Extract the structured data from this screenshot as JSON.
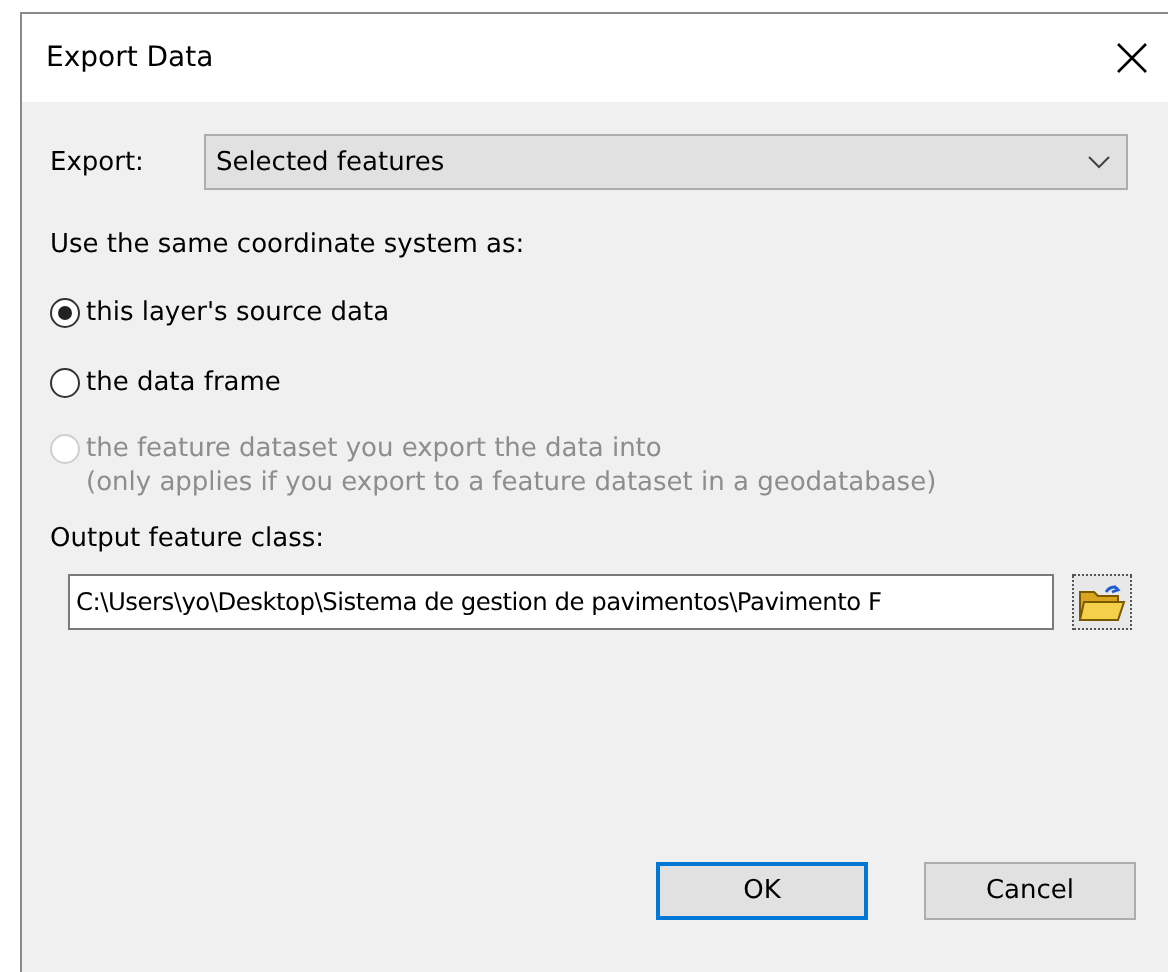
{
  "window": {
    "title": "Export Data"
  },
  "export": {
    "label": "Export:",
    "value": "Selected features"
  },
  "coordinate_heading": "Use the same coordinate system as:",
  "options": [
    {
      "label": "this layer's source data",
      "selected": true,
      "disabled": false
    },
    {
      "label": "the data frame",
      "selected": false,
      "disabled": false
    },
    {
      "label": "the feature dataset you export the data into",
      "note": "(only applies if you export to a feature dataset in a geodatabase)",
      "selected": false,
      "disabled": true
    }
  ],
  "output": {
    "label": "Output feature class:",
    "value": "C:\\Users\\yo\\Desktop\\Sistema de gestion de pavimentos\\Pavimento F"
  },
  "buttons": [
    {
      "label": "OK",
      "default": true
    },
    {
      "label": "Cancel",
      "default": false
    }
  ]
}
